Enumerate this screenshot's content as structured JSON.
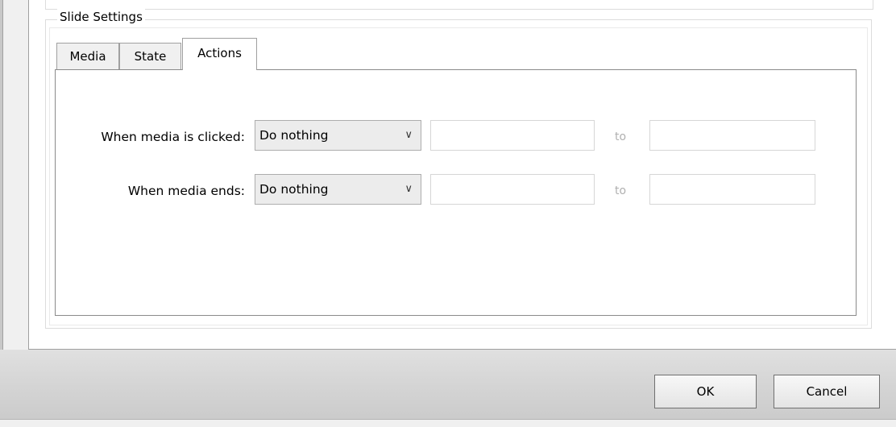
{
  "group": {
    "title": "Slide Settings"
  },
  "tabs": [
    {
      "label": "Media"
    },
    {
      "label": "State"
    },
    {
      "label": "Actions"
    }
  ],
  "actions": {
    "clicked": {
      "label": "When media is clicked:",
      "selected": "Do nothing",
      "to_label": "to"
    },
    "ends": {
      "label": "When media ends:",
      "selected": "Do nothing",
      "to_label": "to"
    }
  },
  "footer": {
    "ok_label": "OK",
    "cancel_label": "Cancel"
  },
  "icons": {
    "dropdown": "chevron-down-icon"
  }
}
